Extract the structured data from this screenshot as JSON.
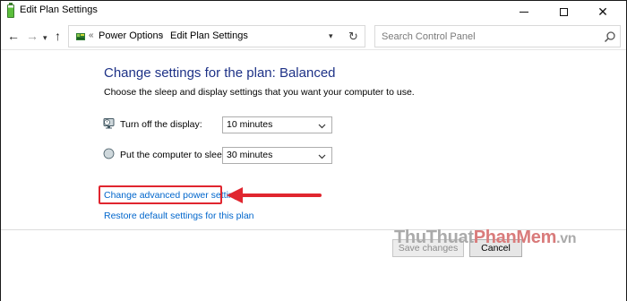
{
  "window": {
    "title": "Edit Plan Settings",
    "controls": {
      "minimize": "—",
      "maximize": "☐",
      "close": "✕"
    }
  },
  "navbar": {
    "back": "←",
    "forward": "→",
    "recent": "▾",
    "up": "↑",
    "breadcrumb": {
      "overflow": "«",
      "items": [
        "Power Options",
        "Edit Plan Settings"
      ],
      "separator": "›"
    },
    "dropdown": "▾",
    "refresh": "↻",
    "search_placeholder": "Search Control Panel"
  },
  "main": {
    "heading": "Change settings for the plan: Balanced",
    "subheading": "Choose the sleep and display settings that you want your computer to use.",
    "settings": [
      {
        "label": "Turn off the display:",
        "value": "10 minutes",
        "icon": "monitor-icon"
      },
      {
        "label": "Put the computer to sleep:",
        "value": "30 minutes",
        "icon": "moon-sleep-icon"
      }
    ],
    "links": {
      "advanced": "Change advanced power settings",
      "restore": "Restore default settings for this plan"
    },
    "buttons": {
      "save": "Save changes",
      "cancel": "Cancel"
    }
  },
  "annotation": {
    "highlight_color": "#e0262f"
  },
  "watermark": {
    "part1": "ThuThuat",
    "part2": "PhanMem",
    "part3": ".vn"
  },
  "colors": {
    "heading": "#1e3287",
    "link": "#0066cc"
  }
}
